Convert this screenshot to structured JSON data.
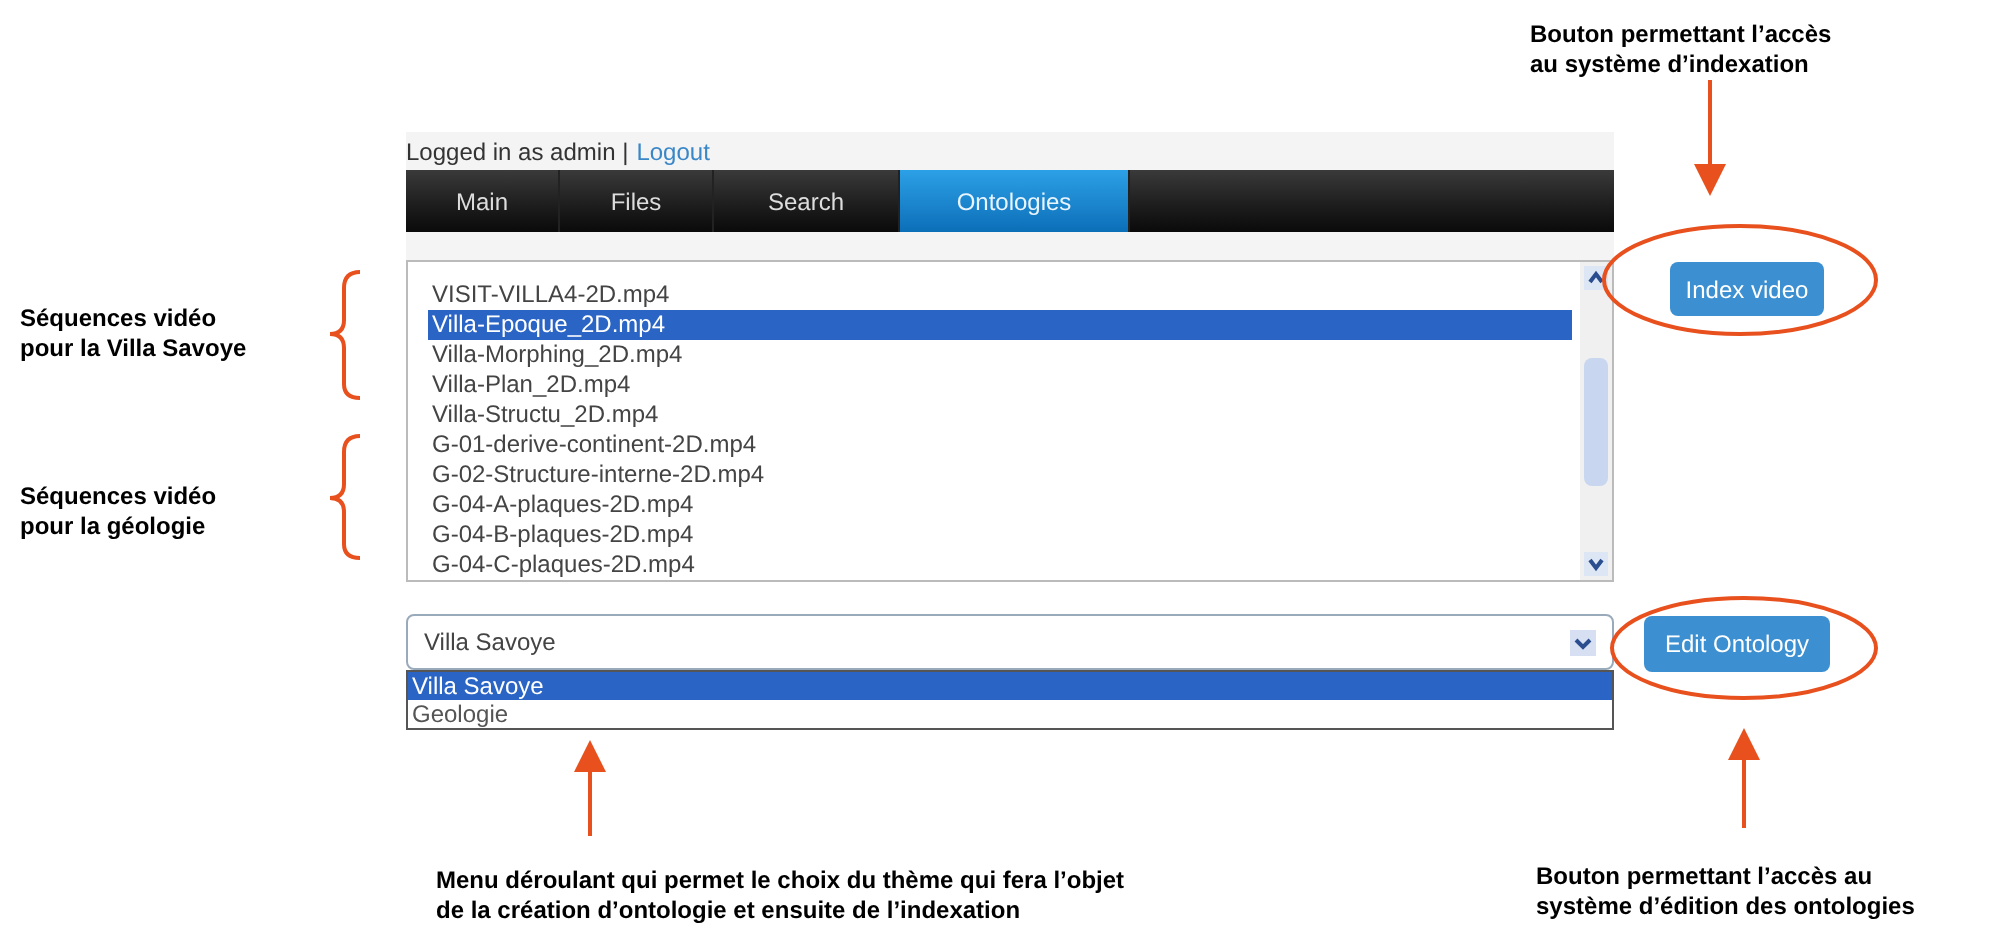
{
  "login": {
    "text": "Logged in as admin |",
    "link": "Logout"
  },
  "nav_tabs": [
    {
      "label": "Main",
      "selected": false
    },
    {
      "label": "Files",
      "selected": false
    },
    {
      "label": "Search",
      "selected": false
    },
    {
      "label": "Ontologies",
      "selected": true
    }
  ],
  "video_list": [
    {
      "label": "VISIT-VILLA4-2D.mp4",
      "selected": false
    },
    {
      "label": "Villa-Epoque_2D.mp4",
      "selected": true
    },
    {
      "label": "Villa-Morphing_2D.mp4",
      "selected": false
    },
    {
      "label": "Villa-Plan_2D.mp4",
      "selected": false
    },
    {
      "label": "Villa-Structu_2D.mp4",
      "selected": false
    },
    {
      "label": "G-01-derive-continent-2D.mp4",
      "selected": false
    },
    {
      "label": "G-02-Structure-interne-2D.mp4",
      "selected": false
    },
    {
      "label": "G-04-A-plaques-2D.mp4",
      "selected": false
    },
    {
      "label": "G-04-B-plaques-2D.mp4",
      "selected": false
    },
    {
      "label": "G-04-C-plaques-2D.mp4",
      "selected": false
    }
  ],
  "index_button": "Index video",
  "theme_select": {
    "value": "Villa Savoye",
    "options": [
      {
        "label": "Villa Savoye",
        "selected": true
      },
      {
        "label": "Geologie",
        "selected": false
      }
    ]
  },
  "edit_button": "Edit Ontology",
  "annotations": [
    {
      "lines": [
        "Bouton permettant l’accès",
        "au système d’indexation"
      ]
    },
    {
      "lines": [
        "Séquences vidéo",
        "pour la Villa Savoye"
      ]
    },
    {
      "lines": [
        "Séquences vidéo",
        "pour la géologie"
      ]
    },
    {
      "lines": [
        "Menu déroulant qui permet le choix du thème qui fera l’objet",
        "de la création d’ontologie et ensuite de l’indexation"
      ]
    },
    {
      "lines": [
        "Bouton permettant l’accès au",
        "système d’édition des ontologies"
      ]
    }
  ]
}
